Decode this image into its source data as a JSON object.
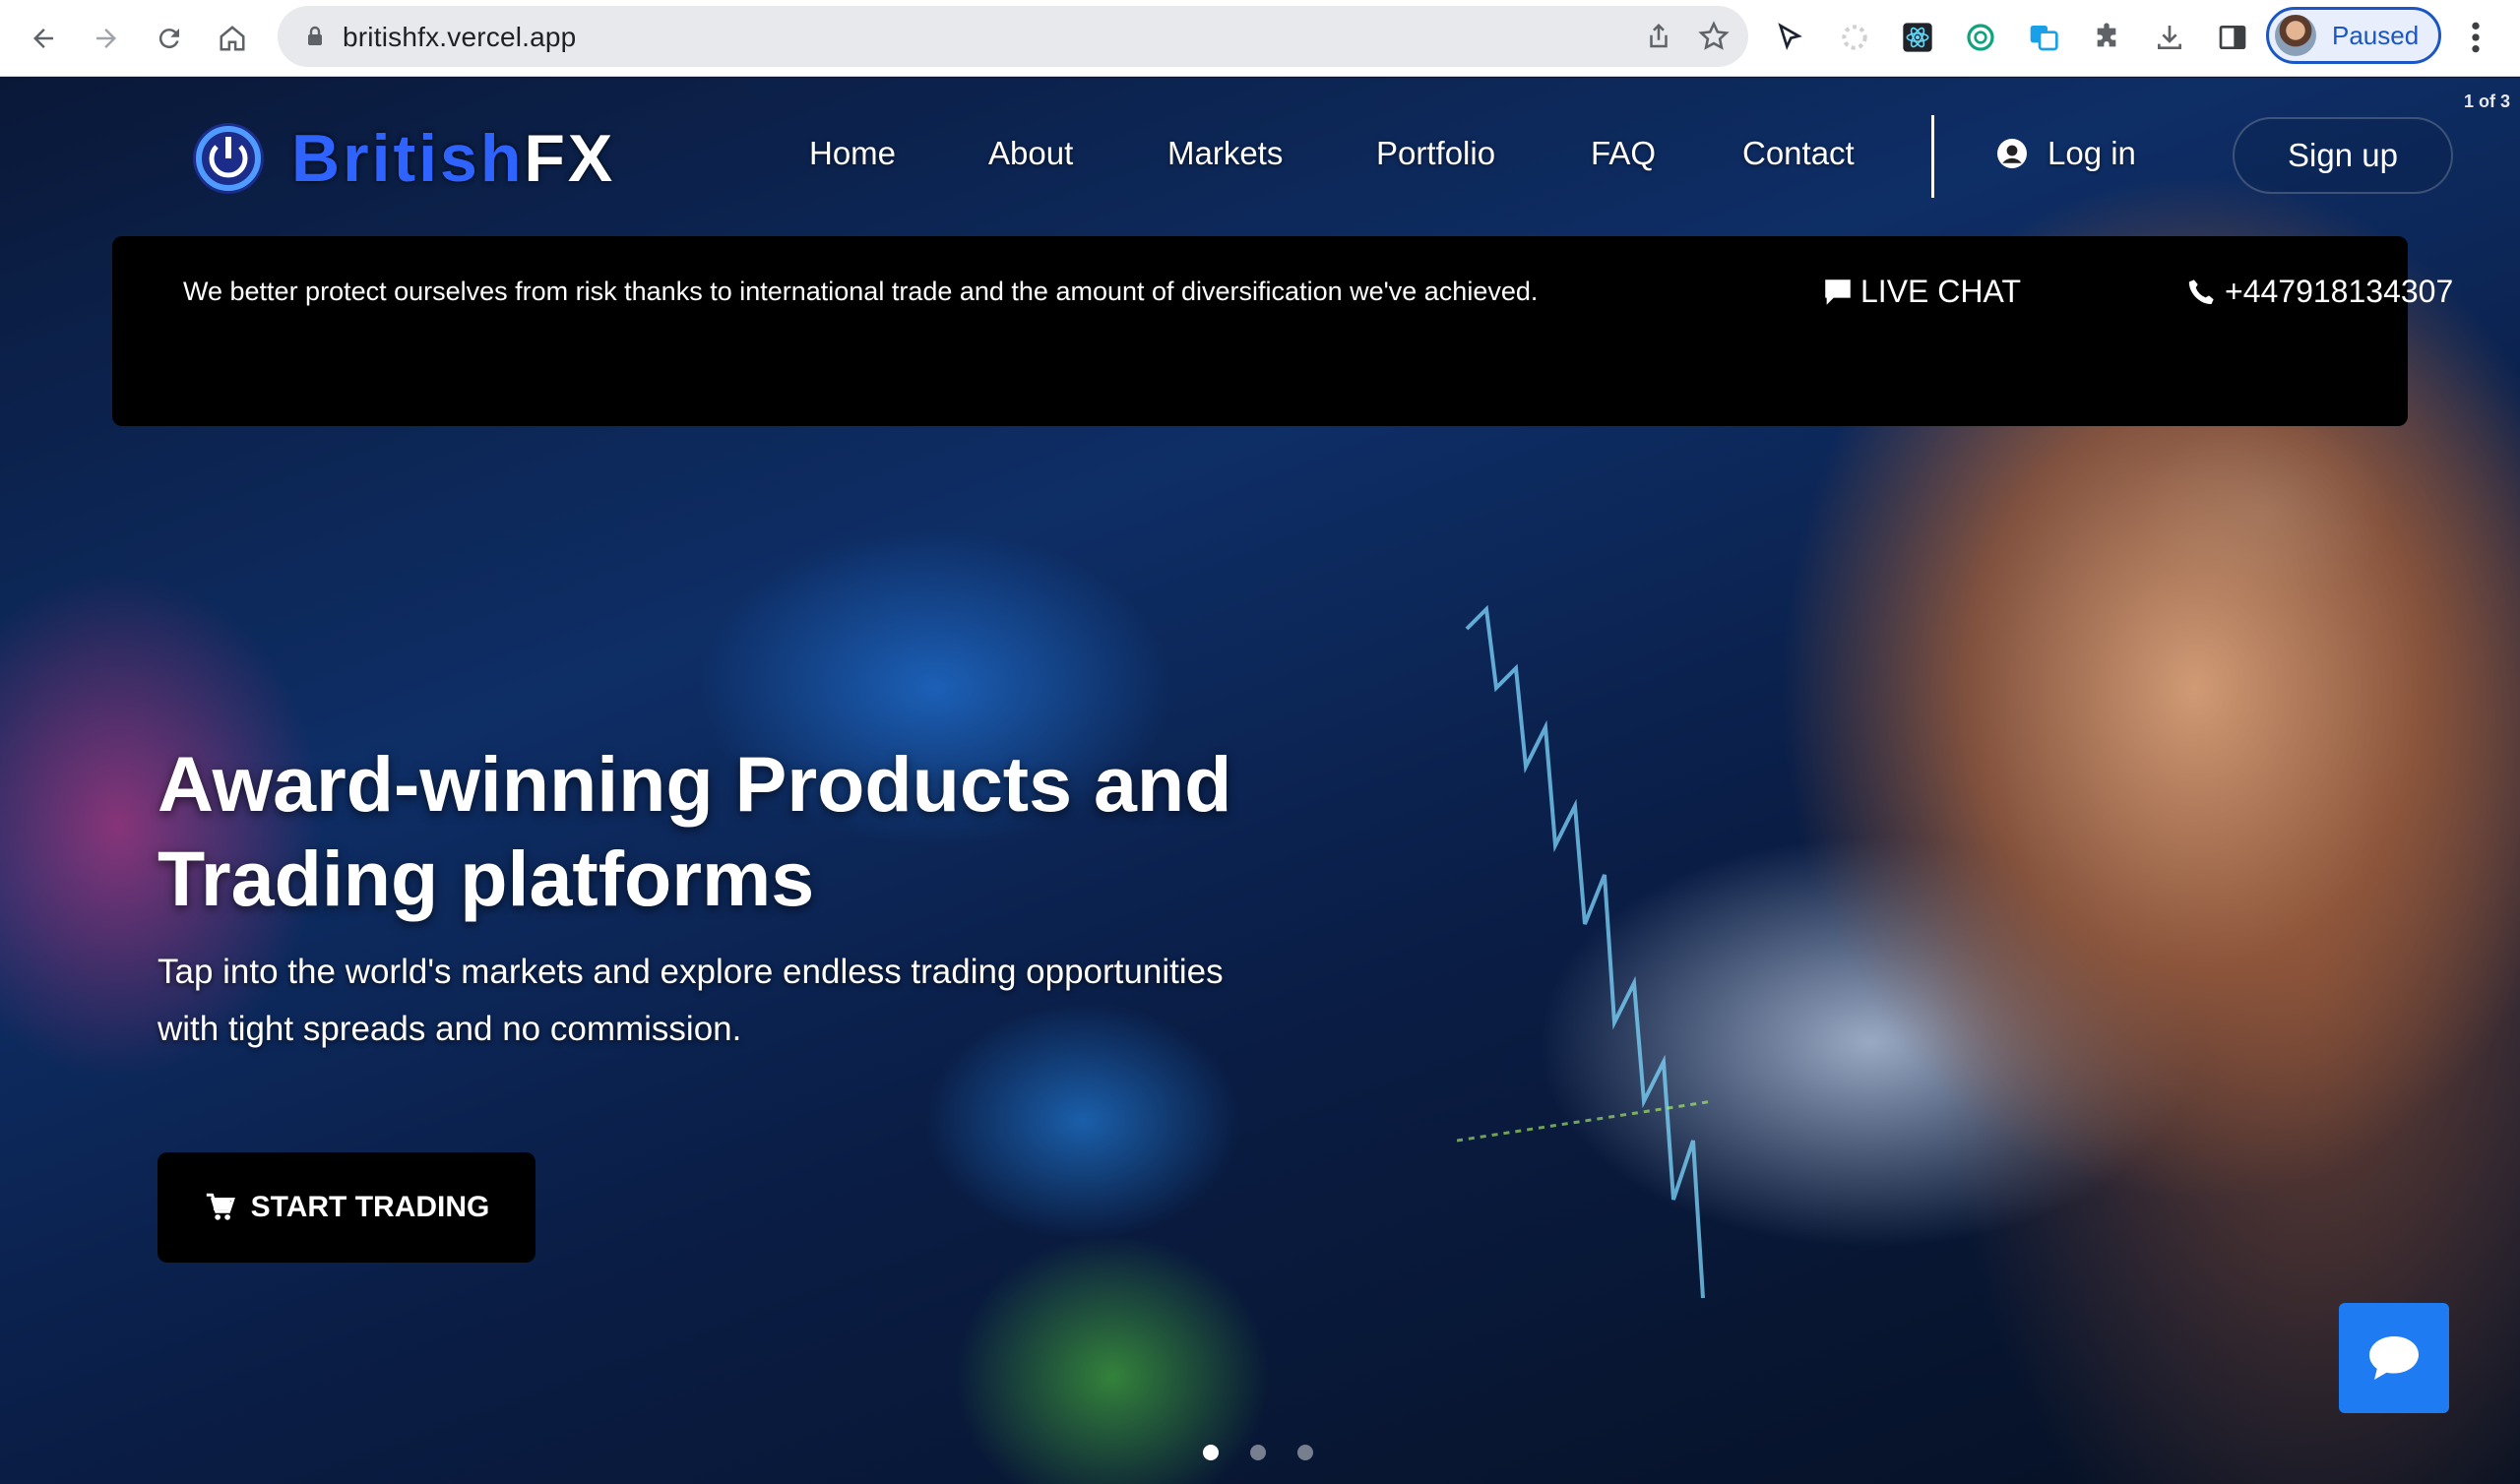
{
  "browser": {
    "url": "britishfx.vercel.app",
    "profile_label": "Paused"
  },
  "site": {
    "logo": {
      "part1": "British",
      "part2": "FX"
    },
    "nav": [
      "Home",
      "About",
      "Markets",
      "Portfolio",
      "FAQ",
      "Contact"
    ],
    "login_label": "Log in",
    "signup_label": "Sign up",
    "slide_counter": "1 of 3"
  },
  "notice": {
    "text": "We better protect ourselves from risk thanks to international trade and the amount of diversification we've achieved.",
    "live_chat_label": "LIVE CHAT",
    "phone": "+447918134307"
  },
  "hero": {
    "title_line1": "Award-winning Products and",
    "title_line2": "Trading platforms",
    "subtitle_line1": "Tap into the world's markets and explore endless trading opportunities",
    "subtitle_line2": "with tight spreads and no commission.",
    "cta_label": "START TRADING"
  },
  "carousel": {
    "count": 3,
    "active": 0
  },
  "colors": {
    "accent": "#1e7bf2",
    "logo_blue": "#2f63ff"
  }
}
